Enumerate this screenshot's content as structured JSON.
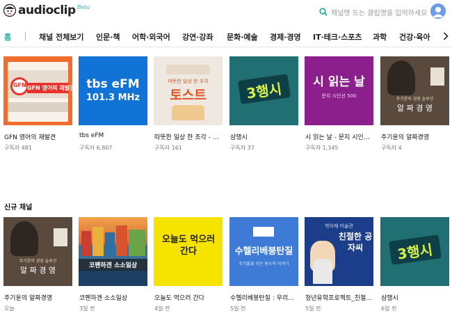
{
  "header": {
    "logo_text": "audioclip",
    "logo_badge": "Beta",
    "search_placeholder": "채널명 또는 클립명을 입력하세요"
  },
  "nav": {
    "items": [
      "홈",
      "채널 전체보기",
      "인문·책",
      "어학·외국어",
      "강연·강좌",
      "문화·예술",
      "경제·경영",
      "IT·테크·스포츠",
      "과학",
      "건강·육아"
    ]
  },
  "row1": [
    {
      "title": "GFN 영어의 재발견",
      "meta": "구독자 481",
      "art": "GFN 영어의 재발견"
    },
    {
      "title": "tbs eFM",
      "meta": "구독자 6,807",
      "art": "tbs eFM",
      "art2": "101.3 MHz"
    },
    {
      "title": "따뜻한 일상 한 조각 - 토...",
      "meta": "구독자 161",
      "art": "따뜻한 일상 한 조각",
      "art2": "토스트"
    },
    {
      "title": "삼행시",
      "meta": "구독자 37",
      "art": "3행시"
    },
    {
      "title": "시 읽는 날 - 문지 시인선 ...",
      "meta": "구독자 1,345",
      "art": "시 읽는 날",
      "art2": "문지 시인선 500"
    },
    {
      "title": "주기윤의 알짜경영",
      "meta": "구독자 4",
      "art": "알 짜 경 영",
      "art2": "주기윤의 경영 솔루션"
    }
  ],
  "section2_title": "신규 채널",
  "row2": [
    {
      "title": "주기윤의 알짜경영",
      "meta": "오늘",
      "art": "알 짜 경 영",
      "art2": "주기윤의 경영 솔루션"
    },
    {
      "title": "코펜하겐 소소일상",
      "meta": "3일 전",
      "art": "코펜하겐 소소일상"
    },
    {
      "title": "오늘도 먹으러 간다",
      "meta": "4일 전",
      "art": "오늘도 먹으러 간다"
    },
    {
      "title": "수헬리베붕탄질 : 우리는 ...",
      "meta": "5일 전",
      "art": "수헬리베붕탄질",
      "art2": "주기율표 모든 원소의 이야기"
    },
    {
      "title": "청년유학프로젝트_친절...",
      "meta": "5일 전",
      "art": "친절한 공자씨",
      "art2": "학아재 미술관"
    },
    {
      "title": "삼행시",
      "meta": "6일 전",
      "art": "3행시"
    }
  ],
  "colors": {
    "accent": "#17a7a0",
    "search_icon": "#1aa49a"
  }
}
